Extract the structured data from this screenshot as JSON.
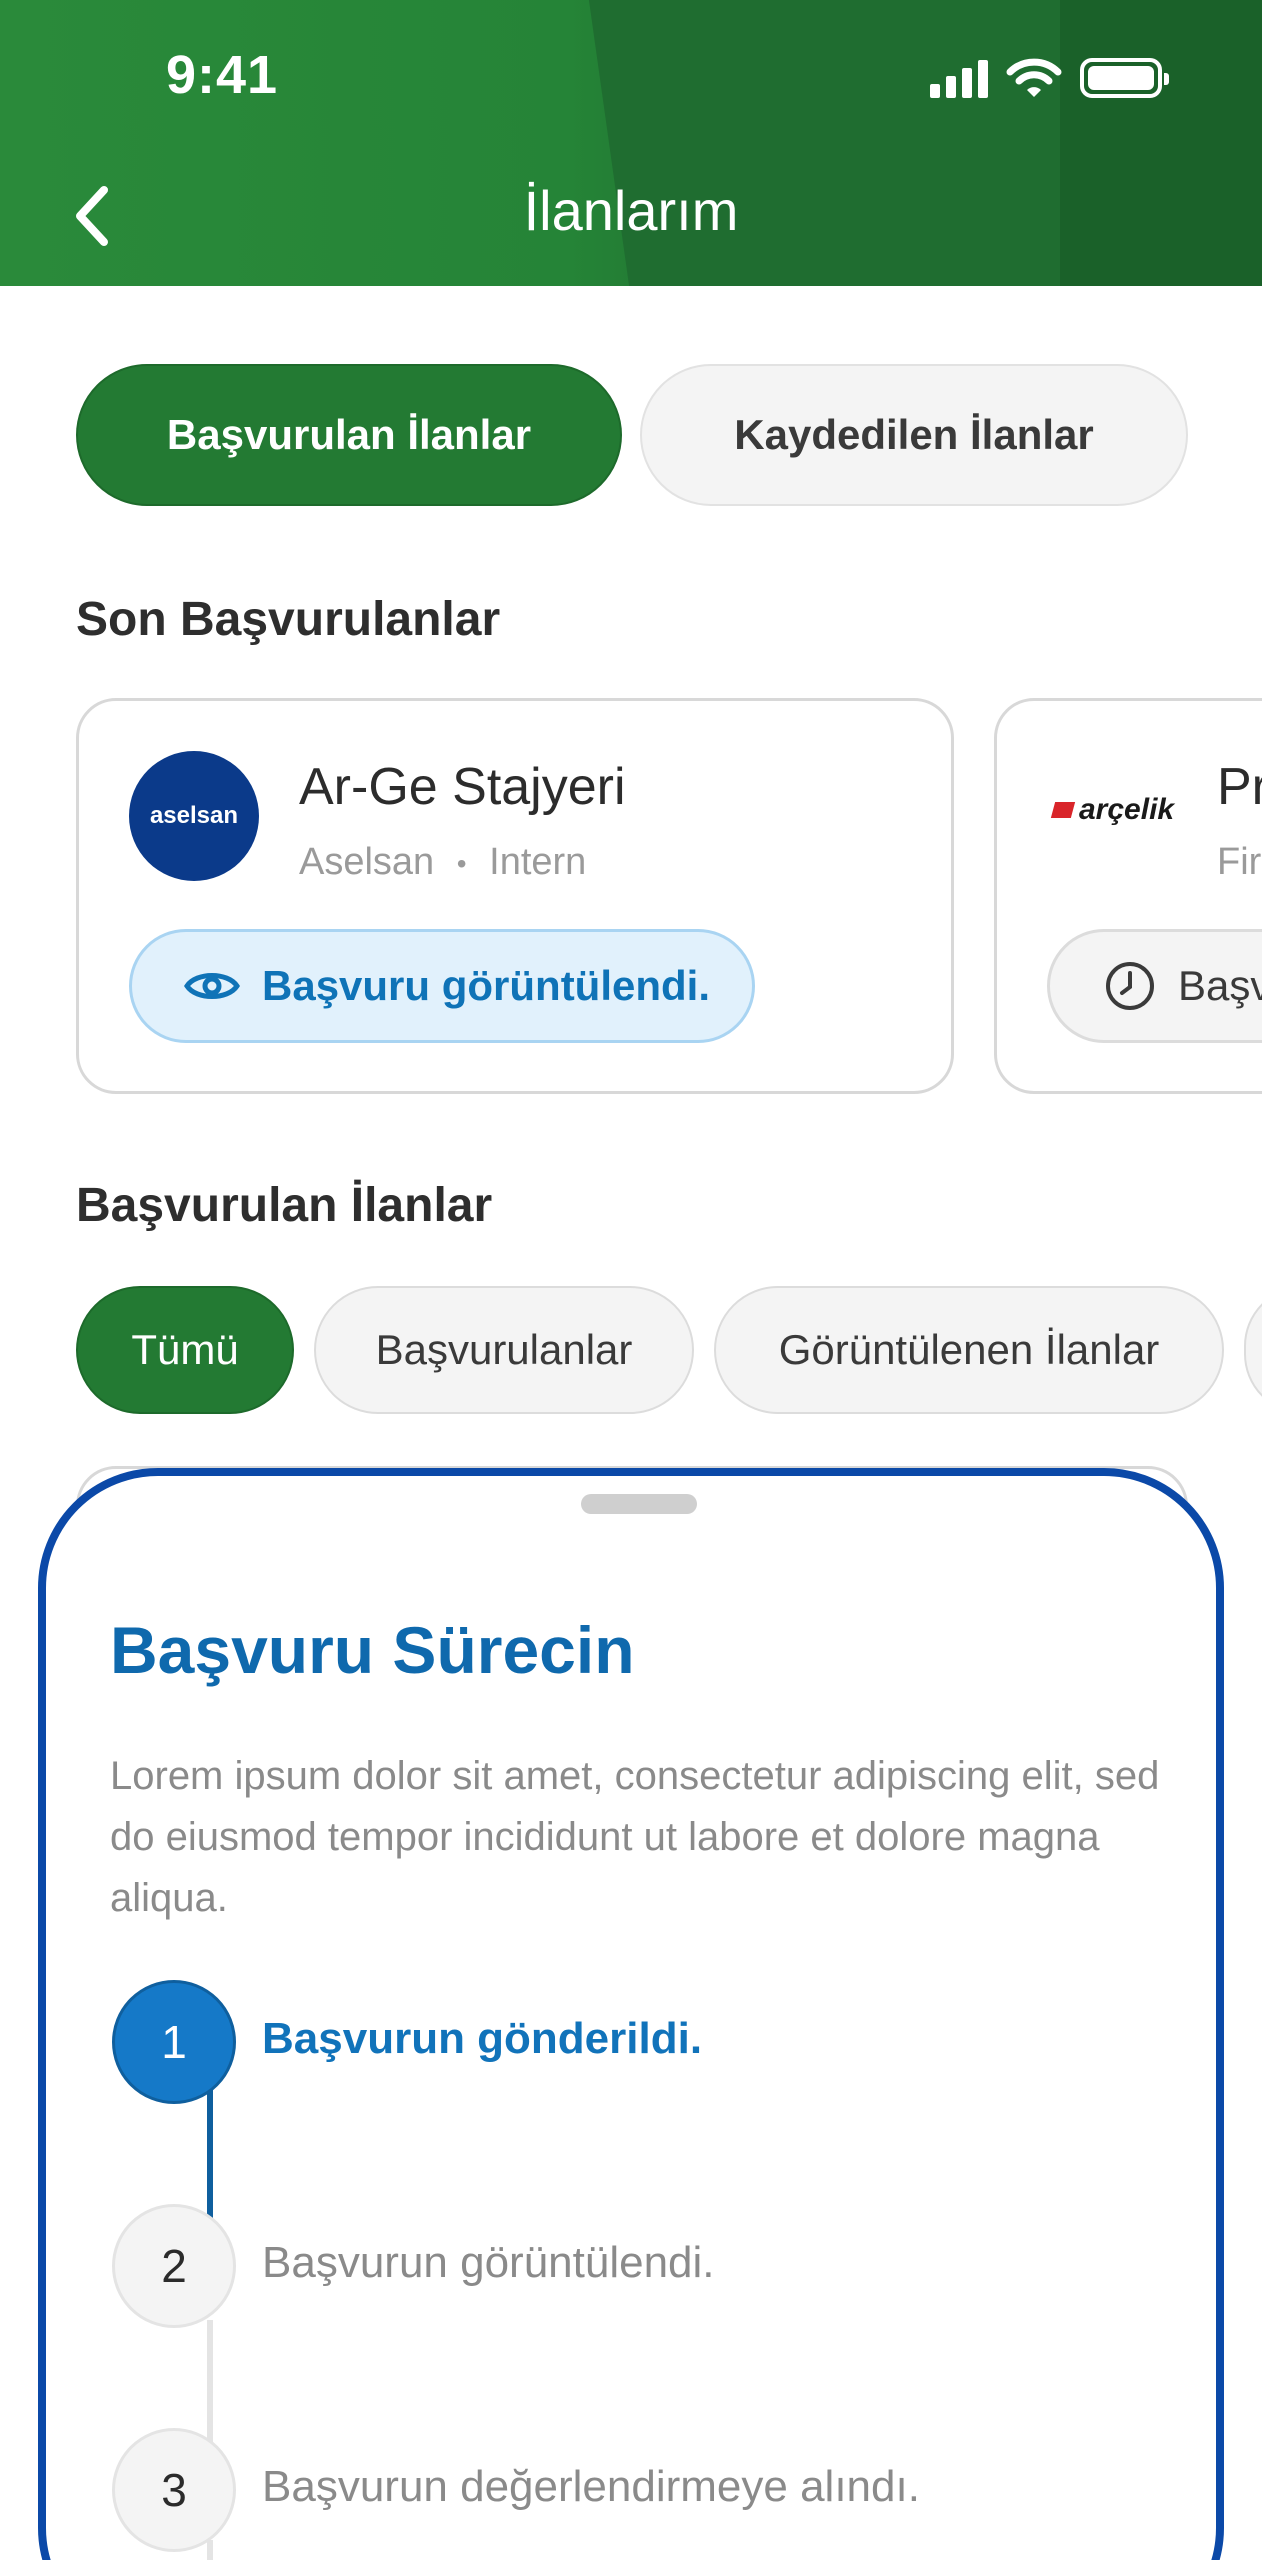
{
  "status_bar": {
    "time": "9:41"
  },
  "header": {
    "title": "İlanlarım"
  },
  "tabs": [
    {
      "label": "Başvurulan İlanlar",
      "active": true
    },
    {
      "label": "Kaydedilen İlanlar",
      "active": false
    }
  ],
  "recent": {
    "section_title": "Son Başvurulanlar",
    "cards": [
      {
        "logo_text": "aselsan",
        "title": "Ar-Ge Stajyeri",
        "company": "Aselsan",
        "separator": "•",
        "type": "Intern",
        "status": "Başvuru görüntülendi.",
        "status_icon": "eye-icon"
      },
      {
        "logo_text": "arçelik",
        "title": "Pr",
        "company": "Fir",
        "status": "Başv",
        "status_icon": "clock-icon"
      }
    ]
  },
  "applied": {
    "section_title": "Başvurulan İlanlar",
    "filters": [
      {
        "label": "Tümü",
        "active": true
      },
      {
        "label": "Başvurulanlar",
        "active": false
      },
      {
        "label": "Görüntülenen İlanlar",
        "active": false
      }
    ]
  },
  "sheet": {
    "title": "Başvuru Sürecin",
    "description": "Lorem ipsum dolor sit amet, consectetur adipiscing elit, sed do eiusmod tempor incididunt ut labore et dolore magna aliqua.",
    "steps": [
      {
        "number": "1",
        "label": "Başvurun gönderildi.",
        "done": true
      },
      {
        "number": "2",
        "label": "Başvurun görüntülendi.",
        "done": false
      },
      {
        "number": "3",
        "label": "Başvurun değerlendirmeye alındı.",
        "done": false
      }
    ]
  },
  "colors": {
    "brand_green": "#237a33",
    "accent_blue": "#0f69ad",
    "sheet_border": "#0b49a8"
  }
}
